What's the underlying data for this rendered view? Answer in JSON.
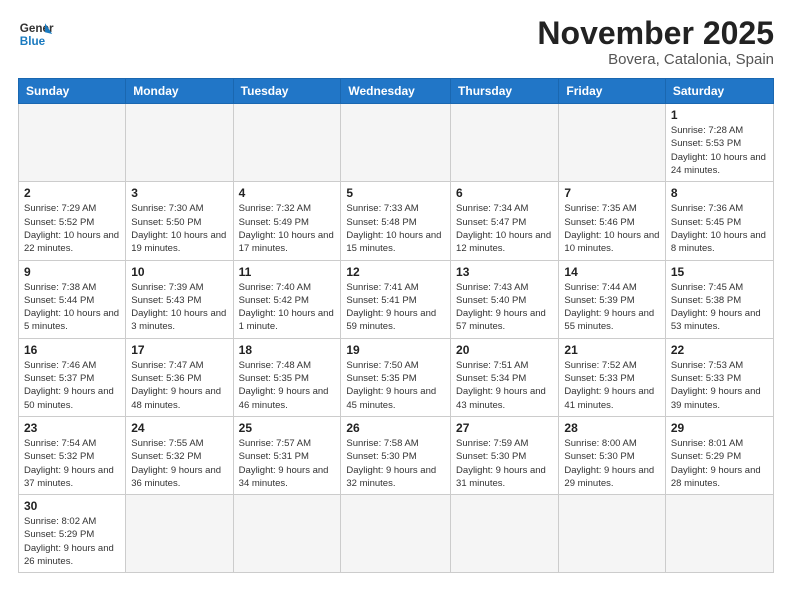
{
  "header": {
    "logo_general": "General",
    "logo_blue": "Blue",
    "month_title": "November 2025",
    "location": "Bovera, Catalonia, Spain"
  },
  "days_of_week": [
    "Sunday",
    "Monday",
    "Tuesday",
    "Wednesday",
    "Thursday",
    "Friday",
    "Saturday"
  ],
  "weeks": [
    [
      {
        "num": "",
        "info": ""
      },
      {
        "num": "",
        "info": ""
      },
      {
        "num": "",
        "info": ""
      },
      {
        "num": "",
        "info": ""
      },
      {
        "num": "",
        "info": ""
      },
      {
        "num": "",
        "info": ""
      },
      {
        "num": "1",
        "info": "Sunrise: 7:28 AM\nSunset: 5:53 PM\nDaylight: 10 hours and 24 minutes."
      }
    ],
    [
      {
        "num": "2",
        "info": "Sunrise: 7:29 AM\nSunset: 5:52 PM\nDaylight: 10 hours and 22 minutes."
      },
      {
        "num": "3",
        "info": "Sunrise: 7:30 AM\nSunset: 5:50 PM\nDaylight: 10 hours and 19 minutes."
      },
      {
        "num": "4",
        "info": "Sunrise: 7:32 AM\nSunset: 5:49 PM\nDaylight: 10 hours and 17 minutes."
      },
      {
        "num": "5",
        "info": "Sunrise: 7:33 AM\nSunset: 5:48 PM\nDaylight: 10 hours and 15 minutes."
      },
      {
        "num": "6",
        "info": "Sunrise: 7:34 AM\nSunset: 5:47 PM\nDaylight: 10 hours and 12 minutes."
      },
      {
        "num": "7",
        "info": "Sunrise: 7:35 AM\nSunset: 5:46 PM\nDaylight: 10 hours and 10 minutes."
      },
      {
        "num": "8",
        "info": "Sunrise: 7:36 AM\nSunset: 5:45 PM\nDaylight: 10 hours and 8 minutes."
      }
    ],
    [
      {
        "num": "9",
        "info": "Sunrise: 7:38 AM\nSunset: 5:44 PM\nDaylight: 10 hours and 5 minutes."
      },
      {
        "num": "10",
        "info": "Sunrise: 7:39 AM\nSunset: 5:43 PM\nDaylight: 10 hours and 3 minutes."
      },
      {
        "num": "11",
        "info": "Sunrise: 7:40 AM\nSunset: 5:42 PM\nDaylight: 10 hours and 1 minute."
      },
      {
        "num": "12",
        "info": "Sunrise: 7:41 AM\nSunset: 5:41 PM\nDaylight: 9 hours and 59 minutes."
      },
      {
        "num": "13",
        "info": "Sunrise: 7:43 AM\nSunset: 5:40 PM\nDaylight: 9 hours and 57 minutes."
      },
      {
        "num": "14",
        "info": "Sunrise: 7:44 AM\nSunset: 5:39 PM\nDaylight: 9 hours and 55 minutes."
      },
      {
        "num": "15",
        "info": "Sunrise: 7:45 AM\nSunset: 5:38 PM\nDaylight: 9 hours and 53 minutes."
      }
    ],
    [
      {
        "num": "16",
        "info": "Sunrise: 7:46 AM\nSunset: 5:37 PM\nDaylight: 9 hours and 50 minutes."
      },
      {
        "num": "17",
        "info": "Sunrise: 7:47 AM\nSunset: 5:36 PM\nDaylight: 9 hours and 48 minutes."
      },
      {
        "num": "18",
        "info": "Sunrise: 7:48 AM\nSunset: 5:35 PM\nDaylight: 9 hours and 46 minutes."
      },
      {
        "num": "19",
        "info": "Sunrise: 7:50 AM\nSunset: 5:35 PM\nDaylight: 9 hours and 45 minutes."
      },
      {
        "num": "20",
        "info": "Sunrise: 7:51 AM\nSunset: 5:34 PM\nDaylight: 9 hours and 43 minutes."
      },
      {
        "num": "21",
        "info": "Sunrise: 7:52 AM\nSunset: 5:33 PM\nDaylight: 9 hours and 41 minutes."
      },
      {
        "num": "22",
        "info": "Sunrise: 7:53 AM\nSunset: 5:33 PM\nDaylight: 9 hours and 39 minutes."
      }
    ],
    [
      {
        "num": "23",
        "info": "Sunrise: 7:54 AM\nSunset: 5:32 PM\nDaylight: 9 hours and 37 minutes."
      },
      {
        "num": "24",
        "info": "Sunrise: 7:55 AM\nSunset: 5:32 PM\nDaylight: 9 hours and 36 minutes."
      },
      {
        "num": "25",
        "info": "Sunrise: 7:57 AM\nSunset: 5:31 PM\nDaylight: 9 hours and 34 minutes."
      },
      {
        "num": "26",
        "info": "Sunrise: 7:58 AM\nSunset: 5:30 PM\nDaylight: 9 hours and 32 minutes."
      },
      {
        "num": "27",
        "info": "Sunrise: 7:59 AM\nSunset: 5:30 PM\nDaylight: 9 hours and 31 minutes."
      },
      {
        "num": "28",
        "info": "Sunrise: 8:00 AM\nSunset: 5:30 PM\nDaylight: 9 hours and 29 minutes."
      },
      {
        "num": "29",
        "info": "Sunrise: 8:01 AM\nSunset: 5:29 PM\nDaylight: 9 hours and 28 minutes."
      }
    ],
    [
      {
        "num": "30",
        "info": "Sunrise: 8:02 AM\nSunset: 5:29 PM\nDaylight: 9 hours and 26 minutes."
      },
      {
        "num": "",
        "info": ""
      },
      {
        "num": "",
        "info": ""
      },
      {
        "num": "",
        "info": ""
      },
      {
        "num": "",
        "info": ""
      },
      {
        "num": "",
        "info": ""
      },
      {
        "num": "",
        "info": ""
      }
    ]
  ]
}
